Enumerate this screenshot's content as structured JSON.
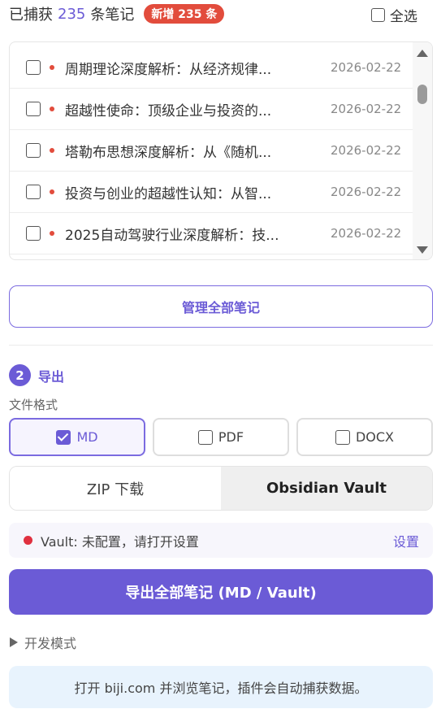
{
  "header": {
    "captured_prefix": "已捕获",
    "captured_count": "235",
    "captured_suffix": "条笔记",
    "new_badge": "新增 235 条",
    "select_all_label": "全选"
  },
  "notes": [
    {
      "title": "周期理论深度解析：从经济规律...",
      "date": "2026-02-22"
    },
    {
      "title": "超越性使命：顶级企业与投资的...",
      "date": "2026-02-22"
    },
    {
      "title": "塔勒布思想深度解析：从《随机...",
      "date": "2026-02-22"
    },
    {
      "title": "投资与创业的超越性认知：从智...",
      "date": "2026-02-22"
    },
    {
      "title": "2025自动驾驶行业深度解析：技...",
      "date": "2026-02-22"
    }
  ],
  "manage_button": "管理全部笔记",
  "export_section": {
    "step_number": "2",
    "step_label": "导出",
    "format_label": "文件格式",
    "formats": [
      {
        "label": "MD",
        "checked": true
      },
      {
        "label": "PDF",
        "checked": false
      },
      {
        "label": "DOCX",
        "checked": false
      }
    ],
    "targets": [
      {
        "label": "ZIP 下载",
        "active": false
      },
      {
        "label": "Obsidian Vault",
        "active": true
      }
    ],
    "vault_status": "Vault: 未配置，请打开设置",
    "vault_settings_link": "设置",
    "export_button": "导出全部笔记 (MD / Vault)"
  },
  "dev_mode_label": "开发模式",
  "info_message": "打开 biji.com 并浏览笔记，插件会自动捕获数据。",
  "colors": {
    "accent": "#6b5bd6",
    "badge": "#e24c3c",
    "status_error": "#e0303f",
    "info_bg": "#e8f3fd"
  }
}
